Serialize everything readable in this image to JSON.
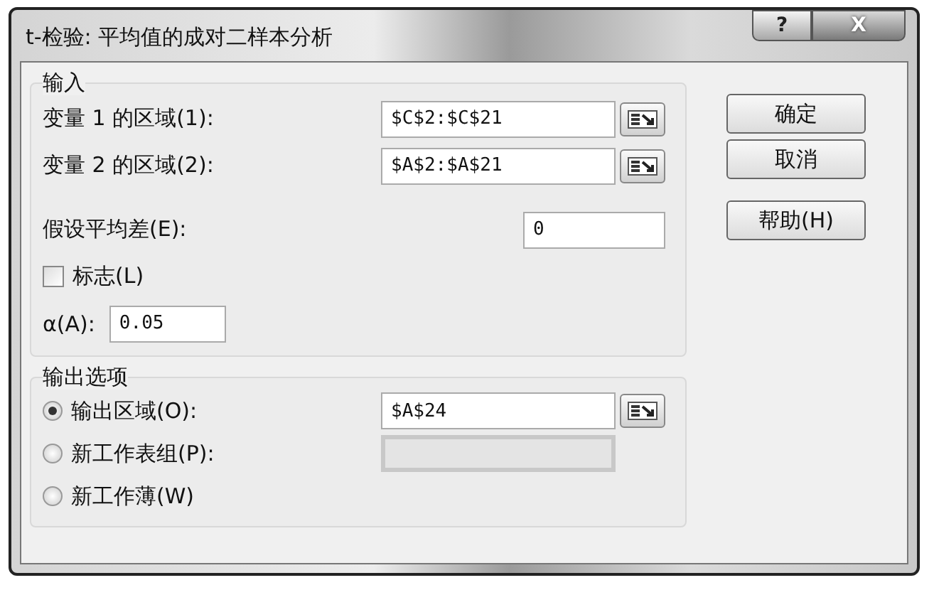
{
  "window": {
    "title": "t-检验: 平均值的成对二样本分析",
    "controls": [
      {
        "kind": "help",
        "label": "?"
      },
      {
        "kind": "close",
        "label": "X"
      }
    ]
  },
  "input_group": {
    "title": "输入",
    "fields": [
      {
        "label": "变量 1 的区域(1):",
        "value": "$C$2:$C$21",
        "picker": true
      },
      {
        "label": "变量 2 的区域(2):",
        "value": "$A$2:$A$21",
        "picker": true
      },
      {
        "label": "假设平均差(E):",
        "value": "0",
        "picker": false
      }
    ],
    "labels_checkbox": {
      "label": "标志(L)",
      "checked": false
    },
    "alpha": {
      "label": "α(A):",
      "value": "0.05"
    }
  },
  "output_group": {
    "title": "输出选项",
    "options": [
      {
        "label": "输出区域(O):",
        "selected": true,
        "field": {
          "value": "$A$24",
          "disabled": false,
          "picker": true
        }
      },
      {
        "label": "新工作表组(P):",
        "selected": false,
        "field": {
          "disabled": true,
          "picker": false
        }
      },
      {
        "label": "新工作薄(W)",
        "selected": false
      }
    ]
  },
  "actions": [
    {
      "label": "确定"
    },
    {
      "label": "取消"
    },
    {
      "label": "帮助(H)"
    }
  ]
}
